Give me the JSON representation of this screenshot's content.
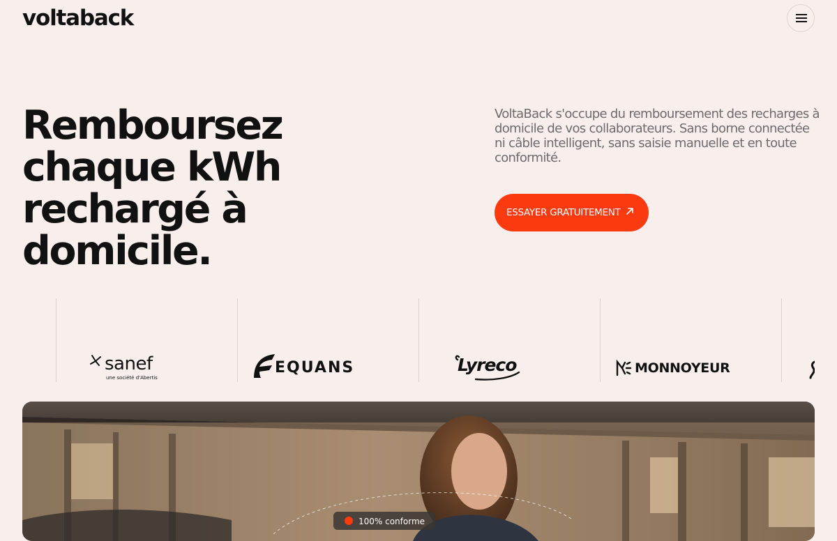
{
  "brand": {
    "logo_text": "voltaback"
  },
  "header": {
    "menu_icon": "hamburger-menu-icon"
  },
  "hero": {
    "title_line1": "Remboursez",
    "title_line2": "chaque kWh",
    "title_line3": "rechargé à domicile.",
    "description": "VoltaBack s'occupe du remboursement des recharges à domicile de vos collaborateurs. Sans borne connectée ni câble intelligent, sans saisie manuelle et en toute conformité.",
    "cta_label": "ESSAYER GRATUITEMENT",
    "cta_icon": "arrow-up-right-icon"
  },
  "clients": [
    {
      "name": "sanef",
      "tagline": "une société d'Abertis"
    },
    {
      "name": "EQUANS"
    },
    {
      "name": "Lyreco"
    },
    {
      "name": "MONNOYEUR"
    }
  ],
  "colors": {
    "background": "#f8efec",
    "accent": "#fb3a10",
    "text": "#111111",
    "muted_text": "#6e6a6c"
  },
  "photo": {
    "overlay_badge": "100% conforme"
  }
}
